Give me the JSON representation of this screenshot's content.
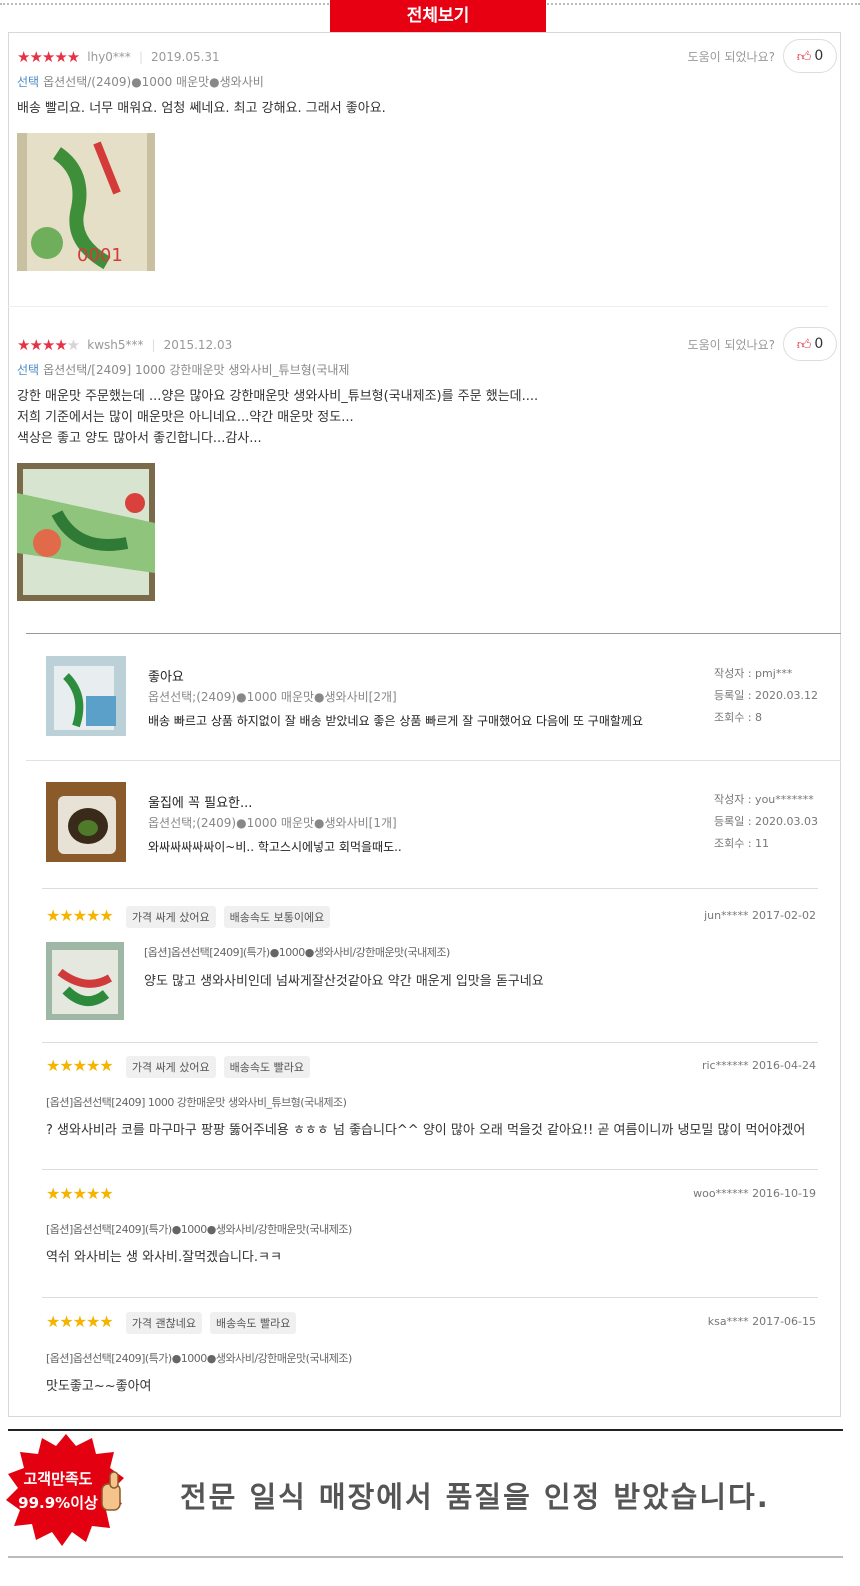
{
  "header": {
    "view_all_label": "전체보기"
  },
  "top_reviews": [
    {
      "rating": 5,
      "stars_on": "★★★★★",
      "stars_off": "",
      "user": "lhy0***",
      "date": "2019.05.31",
      "helpful_label": "도움이 되었나요?",
      "like_count": "0",
      "option_key": "선택",
      "option_value": "옵션선택/(2409)●1000 매운맛●생와사비",
      "body": "배송 빨리요. 너무 매워요. 엄청 쎄네요. 최고 강해요. 그래서 좋아요."
    },
    {
      "rating": 4,
      "stars_on": "★★★★",
      "stars_off": "★",
      "user": "kwsh5***",
      "date": "2015.12.03",
      "helpful_label": "도움이 되었나요?",
      "like_count": "0",
      "option_key": "선택",
      "option_value": "옵션선택/[2409] 1000 강한매운맛 생와사비_튜브형(국내제",
      "body": "강한 매운맛 주문했는데 ...양은 많아요 강한매운맛 생와사비_튜브형(국내제조)를 주문 했는데....\n저희 기준에서는 많이 매운맛은 아니네요...약간 매운맛 정도...\n색상은 좋고 양도 많아서 좋긴합니다...감사..."
    }
  ],
  "mid_reviews": [
    {
      "title": "좋아요",
      "option": "옵션선택;(2409)●1000 매운맛●생와사비[2개]",
      "body": "배송 빠르고 상품 하지없이 잘 배송 받았네요 좋은 상품 빠르게 잘 구매했어요 다음에 또 구매할께요",
      "author_line": "작성자 : pmj***",
      "date_line": "등록일 : 2020.03.12",
      "views_line": "조회수 : 8"
    },
    {
      "title": "울집에 꼭 필요한...",
      "option": "옵션선택;(2409)●1000 매운맛●생와사비[1개]",
      "body": "와싸싸싸싸싸이~비.. 학고스시에넣고 회먹을때도..",
      "author_line": "작성자 : you*******",
      "date_line": "등록일 : 2020.03.03",
      "views_line": "조회수 : 11"
    }
  ],
  "bottom_reviews": [
    {
      "stars": "★★★★★",
      "chips": [
        "가격 싸게 샀어요",
        "배송속도 보통이에요"
      ],
      "user_date": "jun***** 2017-02-02",
      "option": "[옵션]옵션선택[2409](특가)●1000●생와사비/강한매운맛(국내제조)",
      "body": "양도 많고 생와사비인데 넘싸게잘산것같아요 약간 매운게 입맛을 돋구네요",
      "has_photo": true
    },
    {
      "stars": "★★★★★",
      "chips": [
        "가격 싸게 샀어요",
        "배송속도 빨라요"
      ],
      "user_date": "ric****** 2016-04-24",
      "option": "[옵션]옵션선택[2409] 1000 강한매운맛 생와사비_튜브형(국내제조)",
      "body": "? 생와사비라 코를 마구마구 팡팡 뚫어주네용 ㅎㅎㅎ 넘 좋습니다^^ 양이 많아 오래 먹을것 같아요!! 곧 여름이니까 냉모밀 많이 먹어야겠어",
      "has_photo": false
    },
    {
      "stars": "★★★★★",
      "chips": [],
      "user_date": "woo****** 2016-10-19",
      "option": "[옵션]옵션선택[2409](특가)●1000●생와사비/강한매운맛(국내제조)",
      "body": "역쉬 와사비는 생 와사비.잘먹겠습니다.ㅋㅋ",
      "has_photo": false
    },
    {
      "stars": "★★★★★",
      "chips": [
        "가격 괜찮네요",
        "배송속도 빨라요"
      ],
      "user_date": "ksa**** 2017-06-15",
      "option": "[옵션]옵션선택[2409](특가)●1000●생와사비/강한매운맛(국내제조)",
      "body": "맛도좋고~~좋아여",
      "has_photo": false
    }
  ],
  "banner": {
    "badge_line1": "고객만족도",
    "badge_line2": "99.9%이상",
    "text": "전문 일식 매장에서 품질을 인정 받았습니다."
  },
  "colors": {
    "accent": "#e60012",
    "star_red": "#e53346",
    "star_gold": "#f5b400"
  }
}
